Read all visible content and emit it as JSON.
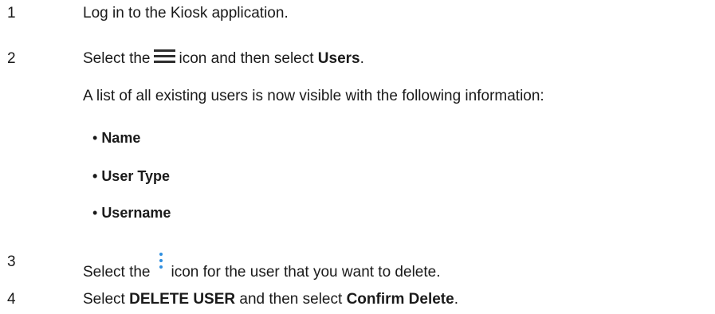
{
  "steps": [
    {
      "number": "1",
      "text": "Log in to the Kiosk application."
    },
    {
      "number": "2",
      "prefix": "Select the",
      "icon": "hamburger-menu-icon",
      "middle": "icon and then select",
      "bold": "Users",
      "suffix": ".",
      "note": "A list of all existing users is now visible with the following information:",
      "bullets": [
        {
          "marker": "•",
          "label": "Name"
        },
        {
          "marker": "•",
          "label": "User Type"
        },
        {
          "marker": "•",
          "label": "Username"
        }
      ]
    },
    {
      "number": "3",
      "prefix": "Select the",
      "icon": "kebab-menu-icon",
      "icon_color": "#2f8fe0",
      "suffix": "icon for the user that you want to delete."
    },
    {
      "number": "4",
      "prefix": "Select",
      "bold1": "DELETE USER",
      "middle": "and then select",
      "bold2": "Confirm Delete",
      "suffix": "."
    }
  ]
}
